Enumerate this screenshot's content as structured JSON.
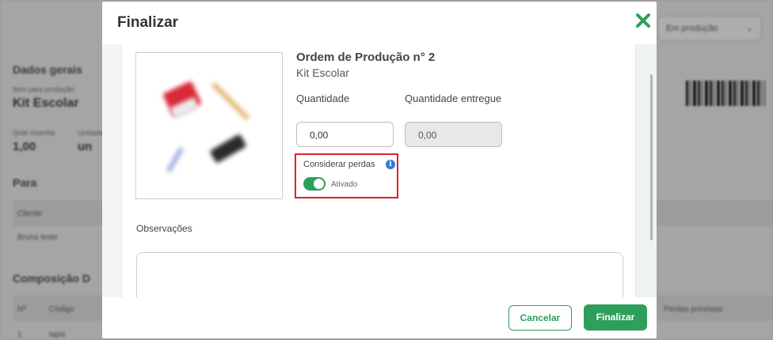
{
  "background": {
    "status_select": "Em produção",
    "section_general": "Dados gerais",
    "item_label": "Item para produção",
    "item_value": "Kit Escolar",
    "qty_label": "Qtde inserida",
    "qty_value": "1,00",
    "unit_label": "Unidade",
    "unit_value": "un",
    "section_for": "Para",
    "client_header": "Cliente",
    "client_value": "Bruna teste",
    "section_composition": "Composição D",
    "col_n": "Nº",
    "col_code": "Código",
    "col_extra": "Perdas previstas",
    "row_n": "1",
    "row_code": "lapis"
  },
  "modal": {
    "title": "Finalizar",
    "close_icon": "close-x-icon",
    "order_title": "Ordem de Produção n° 2",
    "order_subtitle": "Kit Escolar",
    "quantity_label": "Quantidade",
    "quantity_value": "0,00",
    "delivered_label": "Quantidade entregue",
    "delivered_value": "0,00",
    "losses_label": "Considerar perdas",
    "losses_info_icon": "info-icon",
    "losses_toggle_state": "Ativado",
    "observations_label": "Observações",
    "observations_value": "",
    "cancel_label": "Cancelar",
    "finish_label": "Finalizar"
  },
  "colors": {
    "accent": "#2e9e5b",
    "highlight_border": "#d9232d",
    "info": "#2f7fd8"
  }
}
